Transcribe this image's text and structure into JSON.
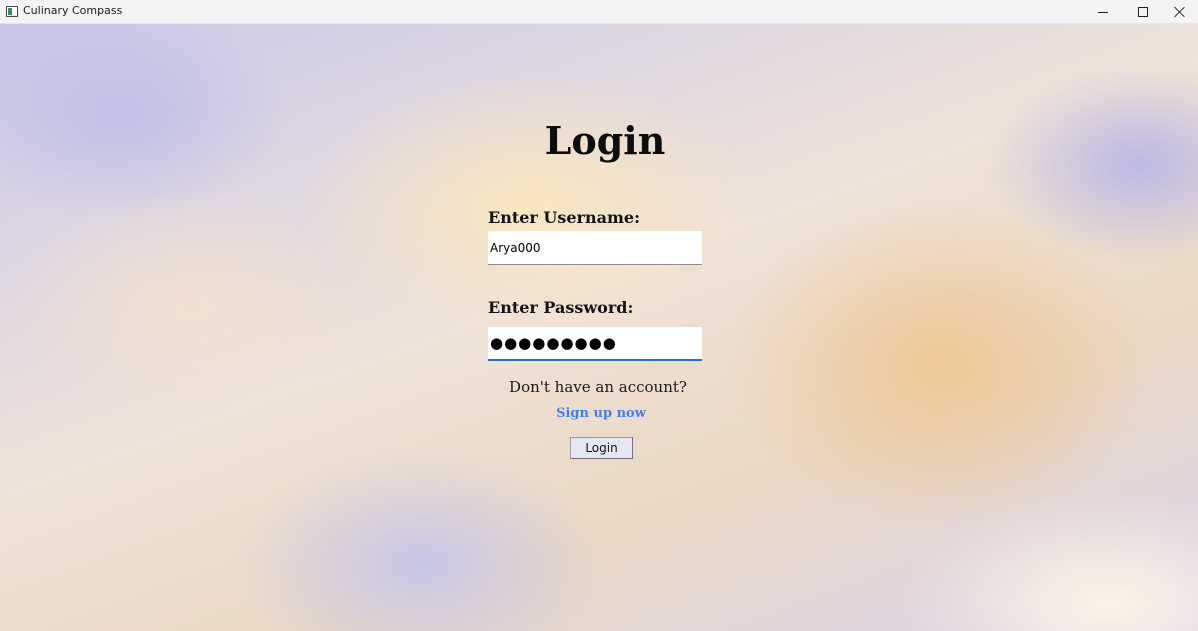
{
  "window": {
    "title": "Culinary Compass",
    "icon": "app-window-icon",
    "controls": [
      "minimize-icon",
      "maximize-icon",
      "close-icon"
    ]
  },
  "login": {
    "heading": "Login",
    "username_label": "Enter Username:",
    "username_value": "Arya000",
    "password_label": "Enter Password:",
    "password_value": "●●●●●●●●●",
    "account_prompt": "Don't have an account?",
    "signup_link": "Sign up now",
    "login_button": "Login"
  },
  "colors": {
    "link": "#4a7fe0",
    "focus_underline": "#2f6fc2"
  }
}
